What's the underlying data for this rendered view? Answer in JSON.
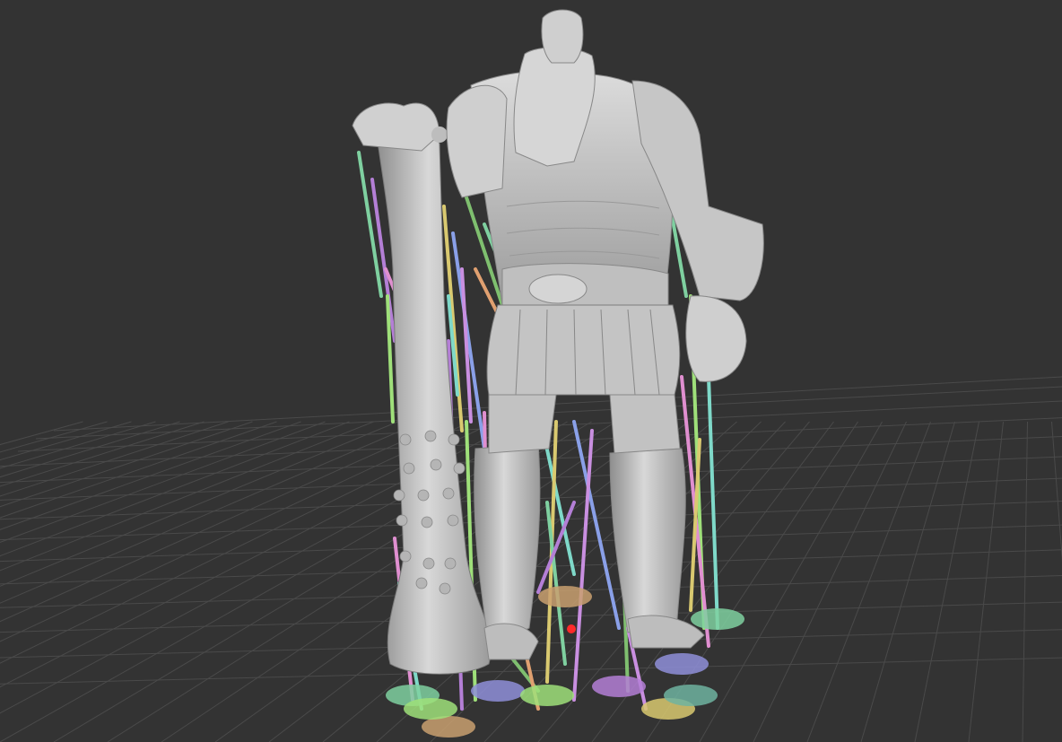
{
  "viewport": {
    "background": "#333333",
    "grid_color": "#4a4a4a",
    "model_color": "#c9c9c9",
    "marker_color": "#ff2a2a"
  },
  "support_colors": [
    "#7fd0a0",
    "#b47fd6",
    "#9fe07a",
    "#e08fd0",
    "#7fd9c9",
    "#d9c970",
    "#8aa0e8",
    "#c98fe0",
    "#7fbf6f",
    "#e0a070"
  ],
  "base_pad_colors": [
    "#7fd0a0",
    "#c9a070",
    "#8f8fd9",
    "#9fe07a",
    "#b47fd6",
    "#d9c970",
    "#6fb3a0"
  ]
}
